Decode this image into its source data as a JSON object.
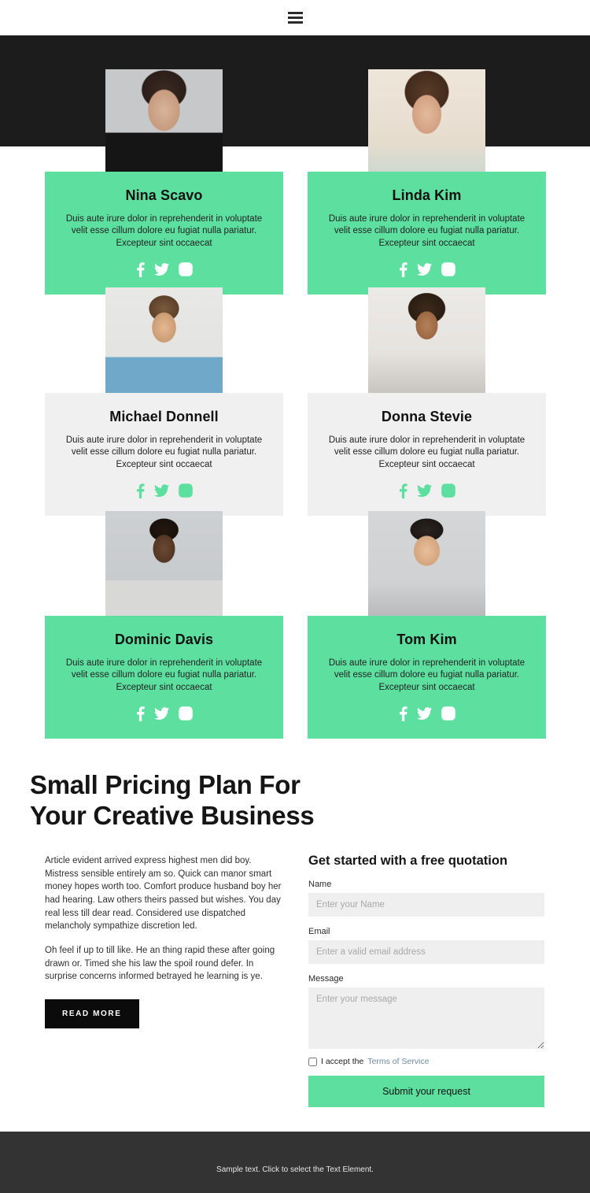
{
  "header": {
    "menu_icon": "hamburger-menu-icon"
  },
  "team": {
    "members": [
      {
        "name": "Nina Scavo",
        "desc": "Duis aute irure dolor in reprehenderit in voluptate velit esse cillum dolore eu fugiat nulla pariatur. Excepteur sint occaecat",
        "style": "green",
        "socials": [
          "facebook-icon",
          "twitter-icon",
          "instagram-icon"
        ]
      },
      {
        "name": "Linda Kim",
        "desc": "Duis aute irure dolor in reprehenderit in voluptate velit esse cillum dolore eu fugiat nulla pariatur. Excepteur sint occaecat",
        "style": "green",
        "socials": [
          "facebook-icon",
          "twitter-icon",
          "instagram-icon"
        ]
      },
      {
        "name": "Michael Donnell",
        "desc": "Duis aute irure dolor in reprehenderit in voluptate velit esse cillum dolore eu fugiat nulla pariatur. Excepteur sint occaecat",
        "style": "grey",
        "socials": [
          "facebook-icon",
          "twitter-icon",
          "instagram-icon"
        ]
      },
      {
        "name": "Donna Stevie",
        "desc": "Duis aute irure dolor in reprehenderit in voluptate velit esse cillum dolore eu fugiat nulla pariatur. Excepteur sint occaecat",
        "style": "grey",
        "socials": [
          "facebook-icon",
          "twitter-icon",
          "instagram-icon"
        ]
      },
      {
        "name": "Dominic Davis",
        "desc": "Duis aute irure dolor in reprehenderit in voluptate velit esse cillum dolore eu fugiat nulla pariatur. Excepteur sint occaecat",
        "style": "green",
        "socials": [
          "facebook-icon",
          "twitter-icon",
          "instagram-icon"
        ]
      },
      {
        "name": "Tom Kim",
        "desc": "Duis aute irure dolor in reprehenderit in voluptate velit esse cillum dolore eu fugiat nulla pariatur. Excepteur sint occaecat",
        "style": "green",
        "socials": [
          "facebook-icon",
          "twitter-icon",
          "instagram-icon"
        ]
      }
    ]
  },
  "pricing": {
    "heading_line1": "Small Pricing Plan For",
    "heading_line2": "Your Creative Business",
    "paragraph1": "Article evident arrived express highest men did boy. Mistress sensible entirely am so. Quick can manor smart money hopes worth too. Comfort produce husband boy her had hearing. Law others theirs passed but wishes. You day real less till dear read. Considered use dispatched melancholy sympathize discretion led.",
    "paragraph2": "Oh feel if up to till like. He an thing rapid these after going drawn or. Timed she his law the spoil round defer. In surprise concerns informed betrayed he learning is ye.",
    "read_more_label": "READ MORE"
  },
  "form": {
    "title": "Get started with a free quotation",
    "name_label": "Name",
    "name_placeholder": "Enter your Name",
    "name_value": "",
    "email_label": "Email",
    "email_placeholder": "Enter a valid email address",
    "email_value": "",
    "message_label": "Message",
    "message_placeholder": "Enter your message",
    "message_value": "",
    "terms_prefix": "I accept the",
    "terms_link": "Terms of Service",
    "terms_checked": false,
    "submit_label": "Submit your request"
  },
  "footer": {
    "text": "Sample text. Click to select the Text Element."
  },
  "colors": {
    "accent_green": "#5cdf9f",
    "card_grey": "#f0f0f0",
    "dark_band": "#1c1c1c",
    "footer_bg": "#333333",
    "link_blue": "#6d8ba6",
    "button_black": "#0b0b0b"
  }
}
